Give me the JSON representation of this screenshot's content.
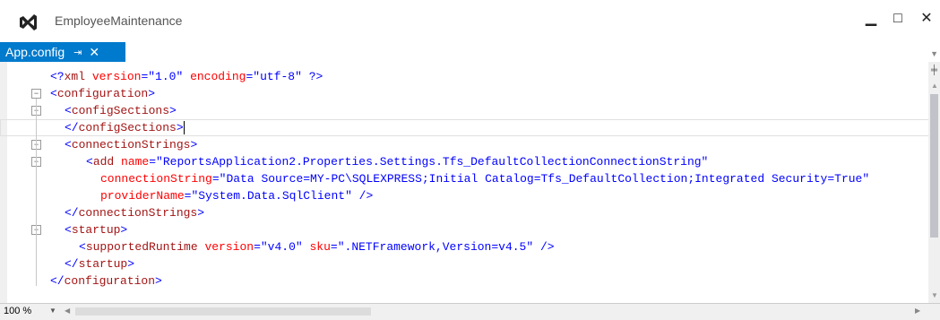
{
  "window": {
    "title": "EmployeeMaintenance",
    "minimize_glyph": "▁",
    "maximize_glyph": "□",
    "close_glyph": "✕"
  },
  "tab": {
    "label": "App.config",
    "pin_glyph": "⇥",
    "close_glyph": "✕"
  },
  "editor": {
    "lines": [
      [
        [
          "punc",
          "<?"
        ],
        [
          "tag",
          "xml"
        ],
        [
          "attr",
          " version"
        ],
        [
          "punc",
          "="
        ],
        [
          "val",
          "\"1.0\""
        ],
        [
          "attr",
          " encoding"
        ],
        [
          "punc",
          "="
        ],
        [
          "val",
          "\"utf-8\""
        ],
        [
          "punc",
          " ?>"
        ]
      ],
      [
        [
          "punc",
          "<"
        ],
        [
          "tag",
          "configuration"
        ],
        [
          "punc",
          ">"
        ]
      ],
      [
        [
          "punc",
          "<"
        ],
        [
          "tag",
          "configSections"
        ],
        [
          "punc",
          ">"
        ]
      ],
      [
        [
          "punc",
          "</"
        ],
        [
          "tag",
          "configSections"
        ],
        [
          "punc",
          ">"
        ]
      ],
      [
        [
          "punc",
          "<"
        ],
        [
          "tag",
          "connectionStrings"
        ],
        [
          "punc",
          ">"
        ]
      ],
      [
        [
          "punc",
          "<"
        ],
        [
          "tag",
          "add"
        ],
        [
          "attr",
          " name"
        ],
        [
          "punc",
          "="
        ],
        [
          "val",
          "\"ReportsApplication2.Properties.Settings.Tfs_DefaultCollectionConnectionString\""
        ]
      ],
      [
        [
          "attr",
          "connectionString"
        ],
        [
          "punc",
          "="
        ],
        [
          "val",
          "\"Data Source=MY-PC\\SQLEXPRESS;Initial Catalog=Tfs_DefaultCollection;Integrated Security=True\""
        ]
      ],
      [
        [
          "attr",
          "providerName"
        ],
        [
          "punc",
          "="
        ],
        [
          "val",
          "\"System.Data.SqlClient\""
        ],
        [
          "punc",
          " />"
        ]
      ],
      [
        [
          "punc",
          "</"
        ],
        [
          "tag",
          "connectionStrings"
        ],
        [
          "punc",
          ">"
        ]
      ],
      [
        [
          "punc",
          "<"
        ],
        [
          "tag",
          "startup"
        ],
        [
          "punc",
          ">"
        ]
      ],
      [
        [
          "punc",
          "<"
        ],
        [
          "tag",
          "supportedRuntime"
        ],
        [
          "attr",
          " version"
        ],
        [
          "punc",
          "="
        ],
        [
          "val",
          "\"v4.0\""
        ],
        [
          "attr",
          " sku"
        ],
        [
          "punc",
          "="
        ],
        [
          "val",
          "\".NETFramework,Version=v4.5\""
        ],
        [
          "punc",
          " />"
        ]
      ],
      [
        [
          "punc",
          "</"
        ],
        [
          "tag",
          "startup"
        ],
        [
          "punc",
          ">"
        ]
      ],
      [
        [
          "punc",
          "</"
        ],
        [
          "tag",
          "configuration"
        ],
        [
          "punc",
          ">"
        ]
      ]
    ],
    "current_line": 4
  },
  "status": {
    "zoom": "100 %"
  },
  "colors": {
    "accent": "#007acc",
    "xml_tag": "#a31515",
    "xml_attr": "#ff0000",
    "xml_value": "#0000ff",
    "xml_punct": "#0000ff"
  }
}
